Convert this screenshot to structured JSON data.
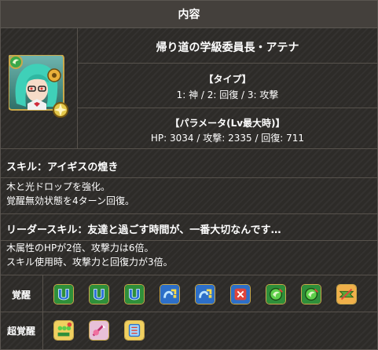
{
  "header": {
    "title": "内容"
  },
  "monster": {
    "name": "帰り道の学級委員長・アテナ",
    "type_heading": "【タイプ】",
    "type_text": "1: 神 / 2: 回復 / 3: 攻撃",
    "param_heading": "【パラメータ(Lv最大時)】",
    "param_text": "HP: 3034 / 攻撃: 2335 / 回復: 711",
    "portrait_icon": "athena-portrait-icon"
  },
  "skill": {
    "title": "スキル：アイギスの煌き",
    "line1": "木と光ドロップを強化。",
    "line2": "覚醒無効状態を4ターン回復。"
  },
  "leader": {
    "title": "リーダースキル：友達と過ごす時間が、一番大切なんです…",
    "line1": "木属性のHPが2倍、攻撃力は6倍。",
    "line2": "スキル使用時、攻撃力と回復力が3倍。"
  },
  "awakenings": {
    "label": "覚醒",
    "icons": [
      "skill-boost-icon",
      "skill-boost-icon",
      "skill-boost-icon",
      "two-prong-attack-icon",
      "two-prong-attack-icon",
      "skill-bind-resist-icon",
      "wood-row-icon",
      "wood-row-icon",
      "recover-bind-icon"
    ]
  },
  "super_awakenings": {
    "label": "超覚醒",
    "icons": [
      "enhanced-combos-icon",
      "guard-break-icon",
      "awoken-bind-resist-icon"
    ]
  }
}
